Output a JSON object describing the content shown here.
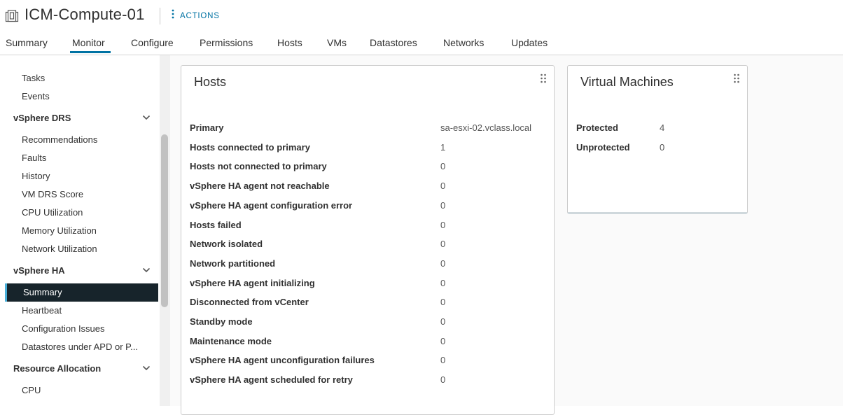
{
  "header": {
    "icon": "cluster-icon",
    "title": "ICM-Compute-01",
    "actions_icon": "vertical-ellipsis-icon",
    "actions_label": "ACTIONS"
  },
  "tabs": [
    {
      "label": "Summary"
    },
    {
      "label": "Monitor",
      "active": true
    },
    {
      "label": "Configure"
    },
    {
      "label": "Permissions"
    },
    {
      "label": "Hosts"
    },
    {
      "label": "VMs"
    },
    {
      "label": "Datastores"
    },
    {
      "label": "Networks"
    },
    {
      "label": "Updates"
    }
  ],
  "sidebar": {
    "top_items": [
      "Tasks",
      "Events"
    ],
    "groups": [
      {
        "label": "vSphere DRS",
        "items": [
          "Recommendations",
          "Faults",
          "History",
          "VM DRS Score",
          "CPU Utilization",
          "Memory Utilization",
          "Network Utilization"
        ]
      },
      {
        "label": "vSphere HA",
        "items": [
          "Summary",
          "Heartbeat",
          "Configuration Issues",
          "Datastores under APD or P..."
        ],
        "selected": "Summary"
      },
      {
        "label": "Resource Allocation",
        "items": [
          "CPU"
        ]
      }
    ]
  },
  "hosts_card": {
    "title": "Hosts",
    "rows": [
      {
        "label": "Primary",
        "value": "sa-esxi-02.vclass.local"
      },
      {
        "label": "Hosts connected to primary",
        "value": "1"
      },
      {
        "label": "Hosts not connected to primary",
        "value": "0"
      },
      {
        "label": "vSphere HA agent not reachable",
        "value": "0"
      },
      {
        "label": "vSphere HA agent configuration error",
        "value": "0"
      },
      {
        "label": "Hosts failed",
        "value": "0"
      },
      {
        "label": "Network isolated",
        "value": "0"
      },
      {
        "label": "Network partitioned",
        "value": "0"
      },
      {
        "label": "vSphere HA agent initializing",
        "value": "0"
      },
      {
        "label": "Disconnected from vCenter",
        "value": "0"
      },
      {
        "label": "Standby mode",
        "value": "0"
      },
      {
        "label": "Maintenance mode",
        "value": "0"
      },
      {
        "label": "vSphere HA agent unconfiguration failures",
        "value": "0"
      },
      {
        "label": "vSphere HA agent scheduled for retry",
        "value": "0"
      }
    ]
  },
  "vms_card": {
    "title": "Virtual Machines",
    "rows": [
      {
        "label": "Protected",
        "value": "4"
      },
      {
        "label": "Unprotected",
        "value": "0"
      }
    ]
  },
  "colors": {
    "accent": "#0072a3",
    "selected_bg": "#17242b",
    "selected_bar": "#49afd9"
  }
}
